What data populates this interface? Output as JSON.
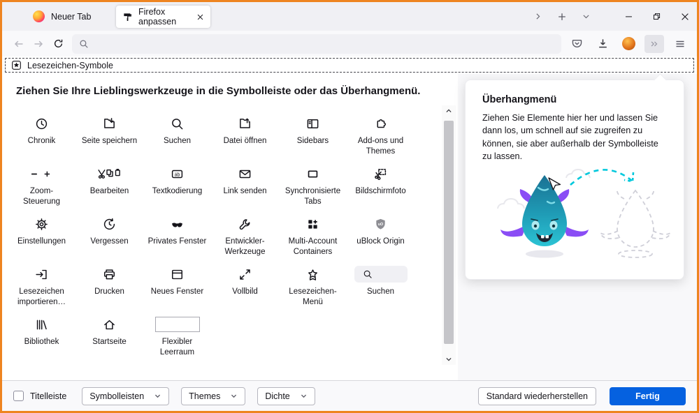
{
  "window": {
    "accent_border": "#ee8420"
  },
  "tab_bar": {
    "inactive_tab": {
      "label": "Neuer Tab",
      "icon": "firefox-logo"
    },
    "active_tab": {
      "label": "Firefox anpassen",
      "icon": "customize-paint-roller-icon",
      "close_icon": "close-icon"
    },
    "buttons": [
      "scroll-tabs-right-icon",
      "new-tab-plus-icon",
      "list-tabs-chevron-down-icon"
    ],
    "window_controls": [
      "minimize-icon",
      "restore-icon",
      "close-icon"
    ]
  },
  "toolbar": {
    "nav_icons": [
      "back-icon",
      "forward-icon",
      "reload-icon"
    ],
    "urlbar": {
      "placeholder": "",
      "icon": "search-icon"
    },
    "right_icons": [
      "pocket-icon",
      "downloads-icon",
      "account-avatar",
      "overflow-chevrons-icon",
      "menu-hamburger-icon"
    ]
  },
  "bookmarks_bar": {
    "label": "Lesezeichen-Symbole",
    "icon": "bookmark-star-box-icon"
  },
  "main": {
    "heading": "Ziehen Sie Ihre Lieblingswerkzeuge in die Symbolleiste oder das Überhangmenü.",
    "palette": {
      "items": [
        {
          "id": "chronik",
          "label": "Chronik",
          "icon": "history"
        },
        {
          "id": "seite-speichern",
          "label": "Seite speichern",
          "icon": "save-page"
        },
        {
          "id": "suchen",
          "label": "Suchen",
          "icon": "search"
        },
        {
          "id": "datei-oeffnen",
          "label": "Datei öffnen",
          "icon": "open-file"
        },
        {
          "id": "sidebars",
          "label": "Sidebars",
          "icon": "sidebars"
        },
        {
          "id": "addons-themes",
          "label": "Add-ons und Themes",
          "icon": "addons"
        },
        {
          "id": "zoom-steuerung",
          "label": "Zoom-Steuerung",
          "icon": "zoom-controls"
        },
        {
          "id": "bearbeiten",
          "label": "Bearbeiten",
          "icon": "edit"
        },
        {
          "id": "textkodierung",
          "label": "Textkodierung",
          "icon": "text-encoding"
        },
        {
          "id": "link-senden",
          "label": "Link senden",
          "icon": "send-link"
        },
        {
          "id": "synchronisierte-tabs",
          "label": "Synchronisierte Tabs",
          "icon": "synced-tabs"
        },
        {
          "id": "bildschirmfoto",
          "label": "Bildschirmfoto",
          "icon": "screenshot"
        },
        {
          "id": "einstellungen",
          "label": "Einstellungen",
          "icon": "settings"
        },
        {
          "id": "vergessen",
          "label": "Vergessen",
          "icon": "forget"
        },
        {
          "id": "privates-fenster",
          "label": "Privates Fenster",
          "icon": "private-window"
        },
        {
          "id": "entwickler-werkzeuge",
          "label": "Entwickler-Werkzeuge",
          "icon": "developer-tools"
        },
        {
          "id": "multi-account-containers",
          "label": "Multi-Account Containers",
          "icon": "containers"
        },
        {
          "id": "ublock-origin",
          "label": "uBlock Origin",
          "icon": "ublock"
        },
        {
          "id": "lesezeichen-importieren",
          "label": "Lesezeichen importieren…",
          "icon": "import-bookmarks"
        },
        {
          "id": "drucken",
          "label": "Drucken",
          "icon": "print"
        },
        {
          "id": "neues-fenster",
          "label": "Neues Fenster",
          "icon": "new-window"
        },
        {
          "id": "vollbild",
          "label": "Vollbild",
          "icon": "fullscreen"
        },
        {
          "id": "lesezeichen-menue",
          "label": "Lesezeichen-Menü",
          "icon": "bookmarks-menu"
        },
        {
          "id": "suchleiste",
          "label": "Suchen",
          "icon": "search-widget"
        },
        {
          "id": "bibliothek",
          "label": "Bibliothek",
          "icon": "library"
        },
        {
          "id": "startseite",
          "label": "Startseite",
          "icon": "home"
        },
        {
          "id": "flexibler-leerraum",
          "label": "Flexibler Leerraum",
          "icon": "flexible-space"
        }
      ]
    }
  },
  "overflow_panel": {
    "title": "Überhangmenü",
    "body": "Ziehen Sie Elemente hier her und lassen Sie dann los, um schnell auf sie zugreifen zu können, sie aber außerhalb der Symbolleiste zu lassen.",
    "illustration": "drop-monster-drag-illustration"
  },
  "footer": {
    "titlebar_label": "Titelleiste",
    "dropdowns": [
      {
        "label": "Symbolleisten"
      },
      {
        "label": "Themes"
      },
      {
        "label": "Dichte"
      }
    ],
    "restore_label": "Standard wiederherstellen",
    "done_label": "Fertig",
    "done_color": "#0561e0"
  }
}
